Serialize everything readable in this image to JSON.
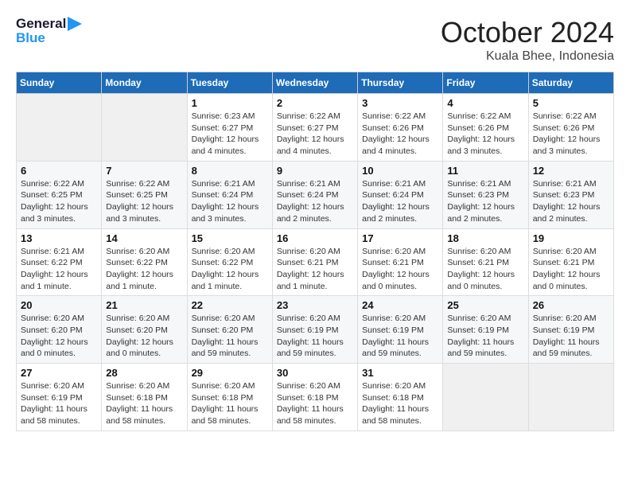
{
  "header": {
    "logo_text_general": "General",
    "logo_text_blue": "Blue",
    "month_title": "October 2024",
    "location": "Kuala Bhee, Indonesia"
  },
  "columns": [
    "Sunday",
    "Monday",
    "Tuesday",
    "Wednesday",
    "Thursday",
    "Friday",
    "Saturday"
  ],
  "weeks": [
    [
      {
        "day": "",
        "info": ""
      },
      {
        "day": "",
        "info": ""
      },
      {
        "day": "1",
        "info": "Sunrise: 6:23 AM\nSunset: 6:27 PM\nDaylight: 12 hours and 4 minutes."
      },
      {
        "day": "2",
        "info": "Sunrise: 6:22 AM\nSunset: 6:27 PM\nDaylight: 12 hours and 4 minutes."
      },
      {
        "day": "3",
        "info": "Sunrise: 6:22 AM\nSunset: 6:26 PM\nDaylight: 12 hours and 4 minutes."
      },
      {
        "day": "4",
        "info": "Sunrise: 6:22 AM\nSunset: 6:26 PM\nDaylight: 12 hours and 3 minutes."
      },
      {
        "day": "5",
        "info": "Sunrise: 6:22 AM\nSunset: 6:26 PM\nDaylight: 12 hours and 3 minutes."
      }
    ],
    [
      {
        "day": "6",
        "info": "Sunrise: 6:22 AM\nSunset: 6:25 PM\nDaylight: 12 hours and 3 minutes."
      },
      {
        "day": "7",
        "info": "Sunrise: 6:22 AM\nSunset: 6:25 PM\nDaylight: 12 hours and 3 minutes."
      },
      {
        "day": "8",
        "info": "Sunrise: 6:21 AM\nSunset: 6:24 PM\nDaylight: 12 hours and 3 minutes."
      },
      {
        "day": "9",
        "info": "Sunrise: 6:21 AM\nSunset: 6:24 PM\nDaylight: 12 hours and 2 minutes."
      },
      {
        "day": "10",
        "info": "Sunrise: 6:21 AM\nSunset: 6:24 PM\nDaylight: 12 hours and 2 minutes."
      },
      {
        "day": "11",
        "info": "Sunrise: 6:21 AM\nSunset: 6:23 PM\nDaylight: 12 hours and 2 minutes."
      },
      {
        "day": "12",
        "info": "Sunrise: 6:21 AM\nSunset: 6:23 PM\nDaylight: 12 hours and 2 minutes."
      }
    ],
    [
      {
        "day": "13",
        "info": "Sunrise: 6:21 AM\nSunset: 6:22 PM\nDaylight: 12 hours and 1 minute."
      },
      {
        "day": "14",
        "info": "Sunrise: 6:20 AM\nSunset: 6:22 PM\nDaylight: 12 hours and 1 minute."
      },
      {
        "day": "15",
        "info": "Sunrise: 6:20 AM\nSunset: 6:22 PM\nDaylight: 12 hours and 1 minute."
      },
      {
        "day": "16",
        "info": "Sunrise: 6:20 AM\nSunset: 6:21 PM\nDaylight: 12 hours and 1 minute."
      },
      {
        "day": "17",
        "info": "Sunrise: 6:20 AM\nSunset: 6:21 PM\nDaylight: 12 hours and 0 minutes."
      },
      {
        "day": "18",
        "info": "Sunrise: 6:20 AM\nSunset: 6:21 PM\nDaylight: 12 hours and 0 minutes."
      },
      {
        "day": "19",
        "info": "Sunrise: 6:20 AM\nSunset: 6:21 PM\nDaylight: 12 hours and 0 minutes."
      }
    ],
    [
      {
        "day": "20",
        "info": "Sunrise: 6:20 AM\nSunset: 6:20 PM\nDaylight: 12 hours and 0 minutes."
      },
      {
        "day": "21",
        "info": "Sunrise: 6:20 AM\nSunset: 6:20 PM\nDaylight: 12 hours and 0 minutes."
      },
      {
        "day": "22",
        "info": "Sunrise: 6:20 AM\nSunset: 6:20 PM\nDaylight: 11 hours and 59 minutes."
      },
      {
        "day": "23",
        "info": "Sunrise: 6:20 AM\nSunset: 6:19 PM\nDaylight: 11 hours and 59 minutes."
      },
      {
        "day": "24",
        "info": "Sunrise: 6:20 AM\nSunset: 6:19 PM\nDaylight: 11 hours and 59 minutes."
      },
      {
        "day": "25",
        "info": "Sunrise: 6:20 AM\nSunset: 6:19 PM\nDaylight: 11 hours and 59 minutes."
      },
      {
        "day": "26",
        "info": "Sunrise: 6:20 AM\nSunset: 6:19 PM\nDaylight: 11 hours and 59 minutes."
      }
    ],
    [
      {
        "day": "27",
        "info": "Sunrise: 6:20 AM\nSunset: 6:19 PM\nDaylight: 11 hours and 58 minutes."
      },
      {
        "day": "28",
        "info": "Sunrise: 6:20 AM\nSunset: 6:18 PM\nDaylight: 11 hours and 58 minutes."
      },
      {
        "day": "29",
        "info": "Sunrise: 6:20 AM\nSunset: 6:18 PM\nDaylight: 11 hours and 58 minutes."
      },
      {
        "day": "30",
        "info": "Sunrise: 6:20 AM\nSunset: 6:18 PM\nDaylight: 11 hours and 58 minutes."
      },
      {
        "day": "31",
        "info": "Sunrise: 6:20 AM\nSunset: 6:18 PM\nDaylight: 11 hours and 58 minutes."
      },
      {
        "day": "",
        "info": ""
      },
      {
        "day": "",
        "info": ""
      }
    ]
  ]
}
